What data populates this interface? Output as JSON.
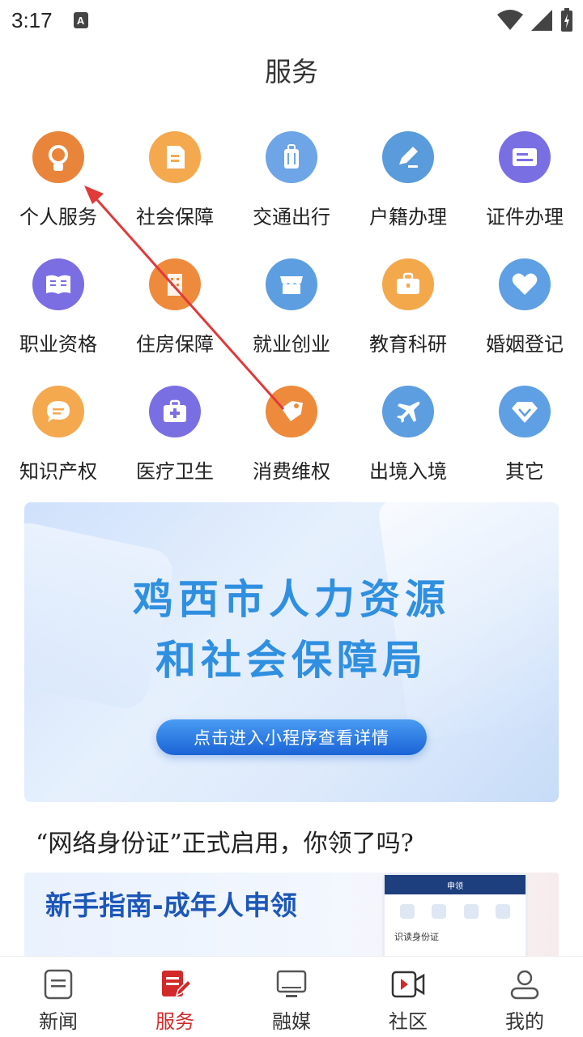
{
  "status_bar": {
    "time": "3:17",
    "notif_letter": "A"
  },
  "page_title": "服务",
  "services": [
    {
      "label": "个人服务",
      "icon": "person-icon",
      "color": "#e9853a"
    },
    {
      "label": "社会保障",
      "icon": "document-icon",
      "color": "#f4a94f"
    },
    {
      "label": "交通出行",
      "icon": "luggage-icon",
      "color": "#6da5e6"
    },
    {
      "label": "户籍办理",
      "icon": "edit-icon",
      "color": "#5a9bdc"
    },
    {
      "label": "证件办理",
      "icon": "card-icon",
      "color": "#7a6fe2"
    },
    {
      "label": "职业资格",
      "icon": "book-icon",
      "color": "#7b6ee3"
    },
    {
      "label": "住房保障",
      "icon": "building-icon",
      "color": "#ee8a3c"
    },
    {
      "label": "就业创业",
      "icon": "store-icon",
      "color": "#5d9ee0"
    },
    {
      "label": "教育科研",
      "icon": "briefcase-icon",
      "color": "#f3a84b"
    },
    {
      "label": "婚姻登记",
      "icon": "heart-icon",
      "color": "#5f9fe4"
    },
    {
      "label": "知识产权",
      "icon": "chat-icon",
      "color": "#f4a94f"
    },
    {
      "label": "医疗卫生",
      "icon": "medkit-icon",
      "color": "#7a6fe2"
    },
    {
      "label": "消费维权",
      "icon": "tag-icon",
      "color": "#ee8a3c"
    },
    {
      "label": "出境入境",
      "icon": "plane-icon",
      "color": "#5d9ee0"
    },
    {
      "label": "其它",
      "icon": "diamond-icon",
      "color": "#5f9fe4"
    }
  ],
  "banner": {
    "line1": "鸡西市人力资源",
    "line2": "和社会保障局",
    "button": "点击进入小程序查看详情"
  },
  "article": {
    "title": "“网络身份证”正式启用，你领了吗?",
    "image_text": "新手指南-成年人申领",
    "image_text2": "\"\"",
    "phone_header": "申领",
    "phone_text": "识读身份证"
  },
  "bottom_nav": [
    {
      "label": "新闻",
      "icon": "news-icon",
      "active": false
    },
    {
      "label": "服务",
      "icon": "service-icon",
      "active": true
    },
    {
      "label": "融媒",
      "icon": "monitor-icon",
      "active": false
    },
    {
      "label": "社区",
      "icon": "video-icon",
      "active": false
    },
    {
      "label": "我的",
      "icon": "profile-icon",
      "active": false
    }
  ],
  "colors": {
    "accent": "#d22a2a",
    "annotation": "#e03a3a"
  }
}
